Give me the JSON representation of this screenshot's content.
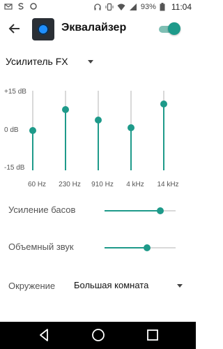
{
  "status_bar": {
    "battery_percent": "93%",
    "time": "11:04",
    "icons": [
      "mail-icon",
      "s-app-icon",
      "ring-icon",
      "headphones-icon",
      "vibrate-icon",
      "wifi-icon",
      "signal-icon",
      "battery-icon"
    ]
  },
  "toolbar": {
    "title": "Эквалайзер",
    "enabled": true
  },
  "preset": {
    "value": "Усилитель FX"
  },
  "eq": {
    "db_top": "+15 dB",
    "db_mid": "0 dB",
    "db_bottom": "-15 dB",
    "bands": [
      {
        "label": "60 Hz",
        "db": 0
      },
      {
        "label": "230 Hz",
        "db": 8
      },
      {
        "label": "910 Hz",
        "db": 4
      },
      {
        "label": "4 kHz",
        "db": 1
      },
      {
        "label": "14 kHz",
        "db": 10
      }
    ]
  },
  "effects": {
    "bass_label": "Усиление басов",
    "bass_level": 0.78,
    "surround_label": "Объемный звук",
    "surround_level": 0.6
  },
  "environment": {
    "label": "Окружение",
    "value": "Большая комната"
  },
  "colors": {
    "accent": "#1e9a8a",
    "track": "#d9d9d9"
  }
}
